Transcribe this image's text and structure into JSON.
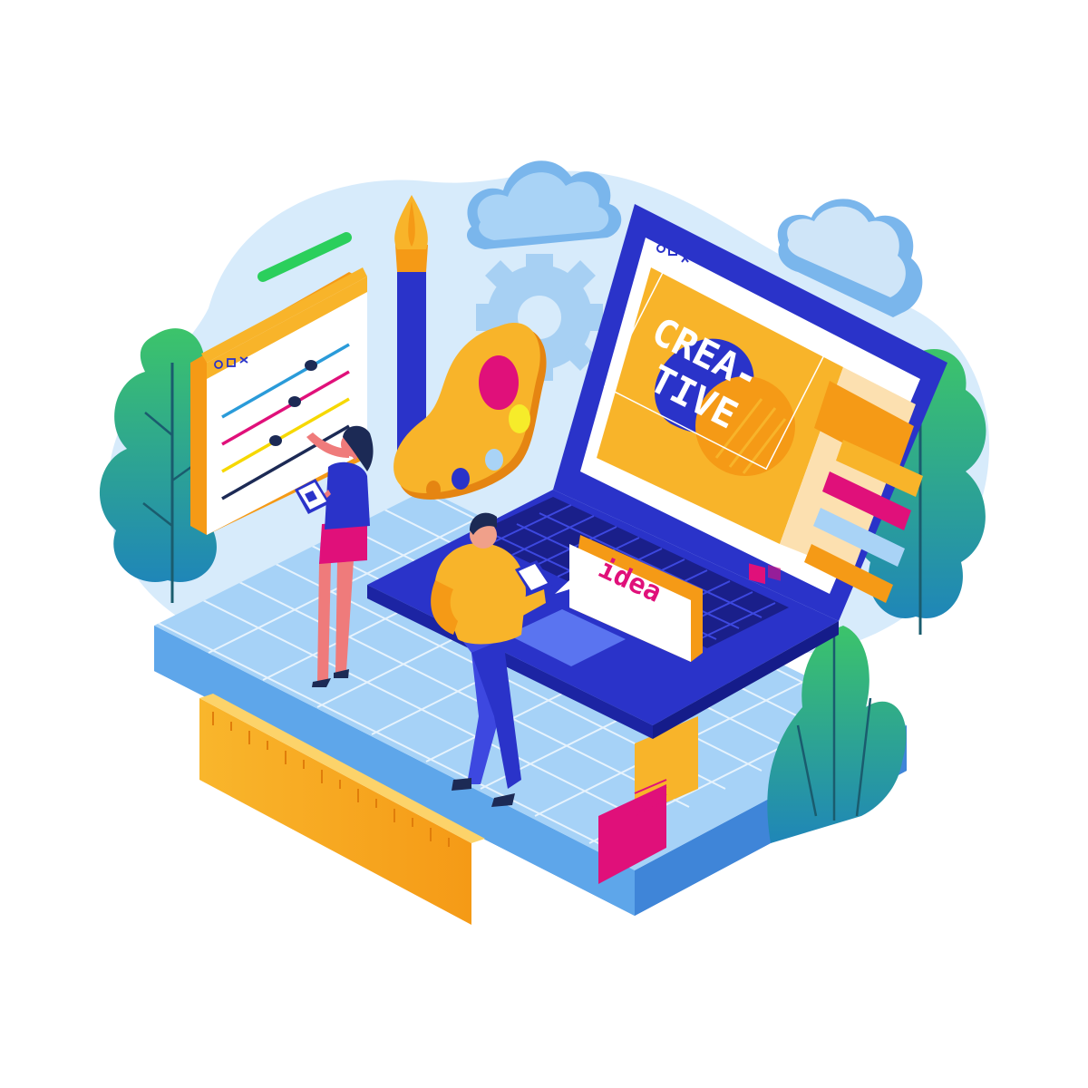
{
  "screen": {
    "headline_line1": "CREA-",
    "headline_line2": "TIVE"
  },
  "speech_bubble": {
    "text": "idea"
  },
  "icons": [
    "cloud-icon",
    "gear-icon",
    "paint-brush-icon",
    "palette-icon",
    "ruler-icon",
    "plant-icon",
    "tablet-icon"
  ],
  "colors": {
    "platform": "#6bb4ef",
    "laptop": "#2a33c9",
    "accent_orange": "#f59a16",
    "accent_yellow": "#f8b42a",
    "accent_magenta": "#e0107a",
    "plant_green": "#2bb57a"
  }
}
